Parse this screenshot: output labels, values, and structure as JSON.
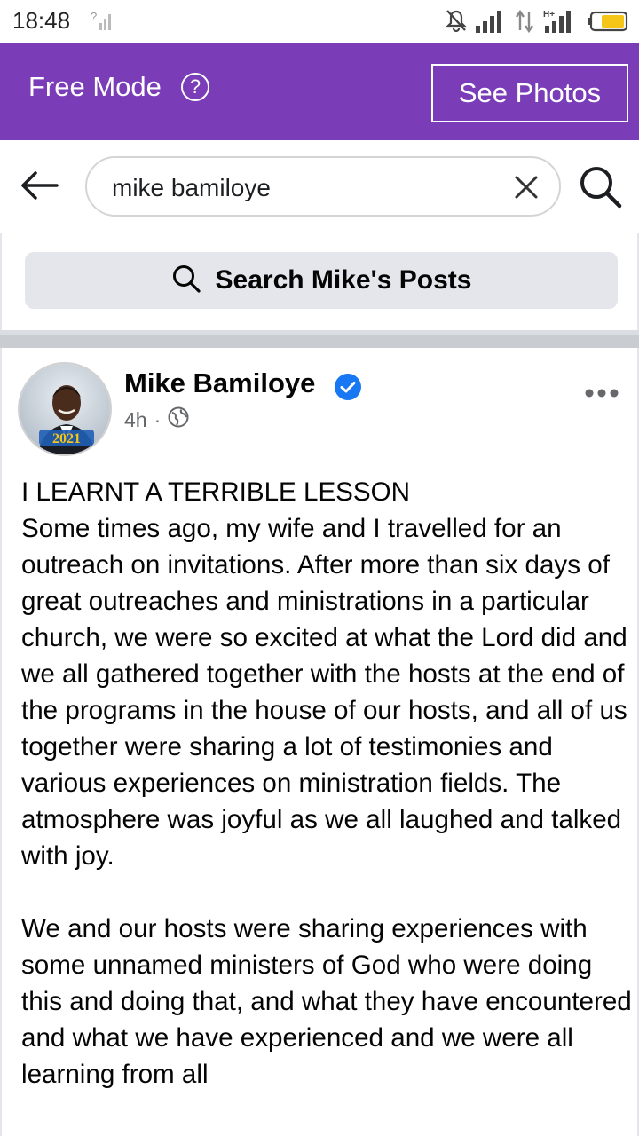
{
  "status_bar": {
    "time": "18:48",
    "icons": [
      "no-sim-signal-icon",
      "mute-icon",
      "signal-icon",
      "data-arrows-icon",
      "hplus-signal-icon",
      "battery-icon"
    ],
    "hplus": "H+"
  },
  "banner": {
    "title": "Free Mode",
    "help_icon": "?",
    "see_photos_label": "See Photos",
    "color": "#7b3cb8"
  },
  "search": {
    "query": "mike bamiloye",
    "back_icon": "arrow-left-icon",
    "clear_icon": "close-icon",
    "search_icon": "search-icon"
  },
  "search_posts": {
    "label": "Search Mike's Posts"
  },
  "post": {
    "author": "Mike Bamiloye",
    "verified": true,
    "time": "4h",
    "separator": "·",
    "audience_icon": "globe-icon",
    "avatar_caption": "2021",
    "body": "I LEARNT A TERRIBLE LESSON\nSome times ago, my wife and I travelled for an outreach on invitations. After more than six days of great outreaches and ministrations in a particular church, we were so excited at what the Lord did and we all gathered together with the hosts at the end of the programs in the house of our hosts, and all of us together were sharing a lot of testimonies and various experiences on ministration fields. The atmosphere was joyful as we all laughed and talked with joy.\n\nWe and our hosts were sharing experiences with some unnamed ministers of God who were doing this and doing that, and what they have encountered and what we have experienced and we were all learning from all"
  }
}
